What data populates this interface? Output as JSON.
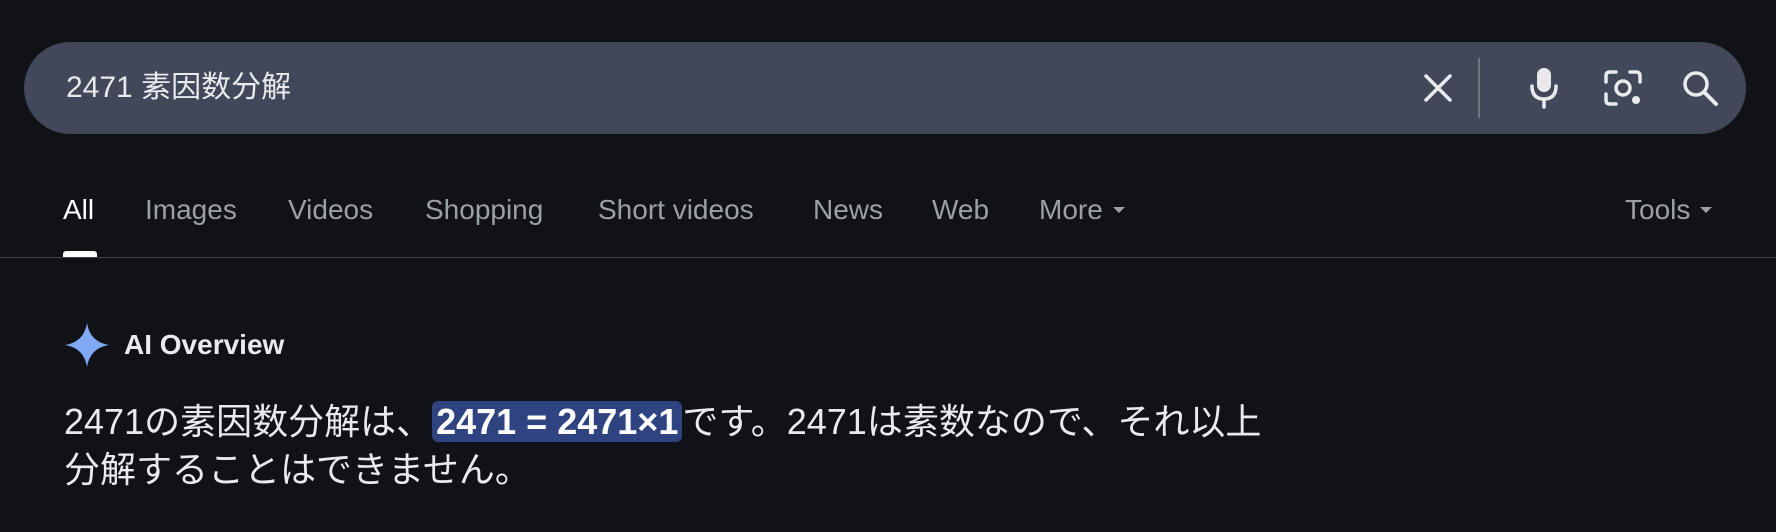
{
  "search": {
    "query": "2471 素因数分解"
  },
  "tabs": {
    "items": [
      {
        "label": "All"
      },
      {
        "label": "Images"
      },
      {
        "label": "Videos"
      },
      {
        "label": "Shopping"
      },
      {
        "label": "Short videos"
      },
      {
        "label": "News"
      },
      {
        "label": "Web"
      },
      {
        "label": "More"
      }
    ],
    "active": "All",
    "tools_label": "Tools"
  },
  "ai_overview": {
    "title": "AI Overview",
    "answer_prefix": "2471の素因数分解は、",
    "answer_highlight": "2471 = 2471×1",
    "answer_line1_suffix": "です。2471は素数なので、それ以上",
    "answer_line2": "分解することはできません。"
  },
  "colors": {
    "background": "#111218",
    "searchbar": "#414859",
    "highlight": "#2f4380",
    "sparkle": "#7fa8f5"
  },
  "icons": [
    "close-icon",
    "mic-icon",
    "camera-lens-icon",
    "search-icon",
    "sparkle-icon",
    "caret-down-icon"
  ]
}
